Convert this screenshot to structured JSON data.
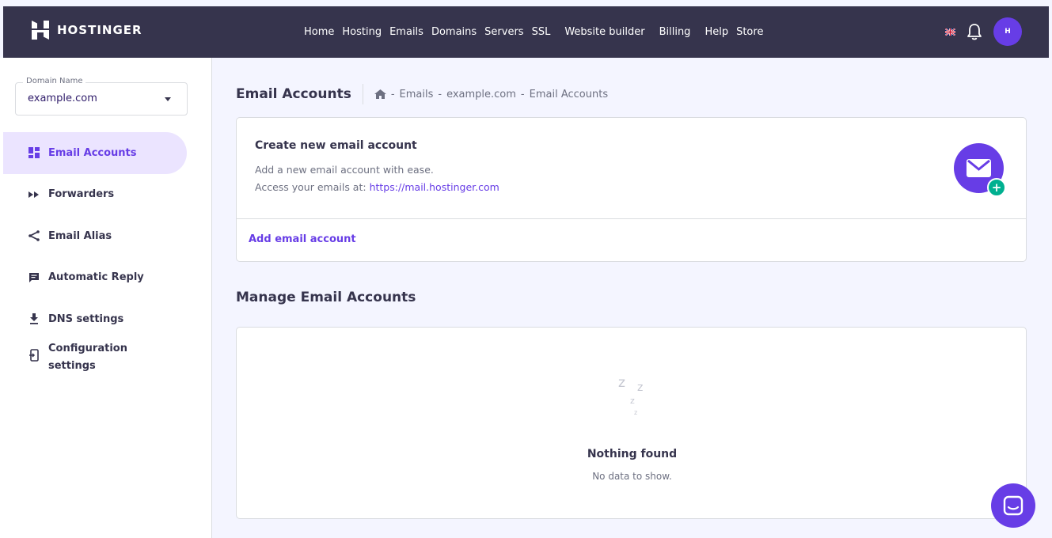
{
  "brand": {
    "name": "HOSTINGER",
    "accent": "#673de6",
    "nav_bg": "#36344d",
    "success": "#00b090"
  },
  "nav": {
    "items": [
      "Home",
      "Hosting",
      "Emails",
      "Domains",
      "Servers",
      "SSL",
      "Website builder",
      "Billing",
      "Help",
      "Store"
    ]
  },
  "top_right": {
    "flag_icon": "uk-flag-icon",
    "bell_icon": "bell-icon",
    "avatar_text": "H"
  },
  "sidebar": {
    "domain_label": "Domain Name",
    "domain_value": "example.com",
    "items": [
      {
        "label": "Email Accounts",
        "icon": "grid-icon",
        "active": true
      },
      {
        "label": "Forwarders",
        "icon": "forward-icon",
        "active": false
      },
      {
        "label": "Email Alias",
        "icon": "share-icon",
        "active": false
      },
      {
        "label": "Automatic Reply",
        "icon": "message-icon",
        "active": false
      },
      {
        "label": "DNS settings",
        "icon": "download-icon",
        "active": false
      },
      {
        "label": "Configuration settings",
        "label_line1": "Configuration",
        "label_line2": "settings",
        "icon": "phone-login-icon",
        "active": false
      }
    ]
  },
  "page": {
    "title": "Email Accounts",
    "breadcrumb": {
      "sep1": "-",
      "emails": "Emails",
      "sep2": "-",
      "domain": "example.com",
      "sep3": "-",
      "current": "Email Accounts"
    }
  },
  "create_card": {
    "title": "Create new email account",
    "desc_line1": "Add a new email account with ease.",
    "desc_line2_prefix": "Access your emails at: ",
    "link": "https://mail.hostinger.com",
    "action": "Add email account",
    "plus": "+"
  },
  "manage": {
    "title": "Manage Email Accounts",
    "empty_title": "Nothing found",
    "empty_desc": "No data to show.",
    "zzz": [
      "z",
      "z",
      "z",
      "z"
    ]
  }
}
